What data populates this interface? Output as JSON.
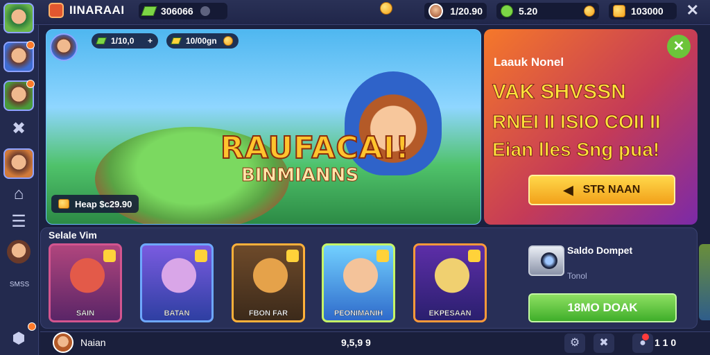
{
  "header": {
    "title": "IINARAAI",
    "gems": "306066",
    "player_score": "1/20.90",
    "energy": "5.20",
    "gold": "103000",
    "close_glyph": "✕"
  },
  "sidebar": {
    "items": [
      {
        "icon": "avatar-player"
      },
      {
        "icon": "avatar-friend-1"
      },
      {
        "icon": "avatar-friend-2"
      },
      {
        "icon": "puzzle-icon",
        "glyph": "✖"
      },
      {
        "icon": "avatar-friend-3"
      },
      {
        "icon": "shop-icon",
        "glyph": "⌂"
      },
      {
        "icon": "list-icon",
        "glyph": "☰"
      },
      {
        "icon": "avatar-friend-4"
      }
    ],
    "bottom_label": "SMSS"
  },
  "hero": {
    "pill1": "1/10,0",
    "pill2": "10/00gn",
    "title": "RAUFACAI!",
    "subtitle": "BINMIANNS",
    "caption": "Heap $c29.90"
  },
  "promo": {
    "kicker": "Laauk Nonel",
    "line1": "VAK SHVSSN",
    "line2": "RNEI II ISIO COII II",
    "line3": "Eian lles Sng pua!",
    "button": "STR NAAN"
  },
  "collection": {
    "title": "Selale Vim",
    "cards": [
      {
        "name": "SAIN",
        "frame": "#d3558f",
        "bg1": "#b0457d",
        "bg2": "#5a2567",
        "art": "#e35a49"
      },
      {
        "name": "BATAN",
        "frame": "#6ea8ff",
        "bg1": "#7a5be0",
        "bg2": "#2e3fa2",
        "art": "#d9a6e8"
      },
      {
        "name": "FBON FAR",
        "frame": "#ffb13a",
        "bg1": "#6e4a2a",
        "bg2": "#3c2a1a",
        "art": "#e5a24a"
      },
      {
        "name": "PEONIMANIH",
        "frame": "#c6f566",
        "bg1": "#72d0ff",
        "bg2": "#2f6bcb",
        "art": "#f4c39a"
      },
      {
        "name": "EKPESAAN",
        "frame": "#ff9a3a",
        "bg1": "#5d2ea8",
        "bg2": "#2a1f6e",
        "art": "#f0d070"
      }
    ]
  },
  "wallet": {
    "title": "Saldo Dompet",
    "subtitle": "Tonol",
    "button": "18MO DOAK"
  },
  "footer": {
    "name": "Naian",
    "score": "9,5,9 9",
    "count": "1 1 0"
  },
  "colors": {
    "bg": "#1b2140",
    "accent_orange": "#f5782a",
    "accent_green": "#3fae2a",
    "gold": "#ffc42e"
  }
}
